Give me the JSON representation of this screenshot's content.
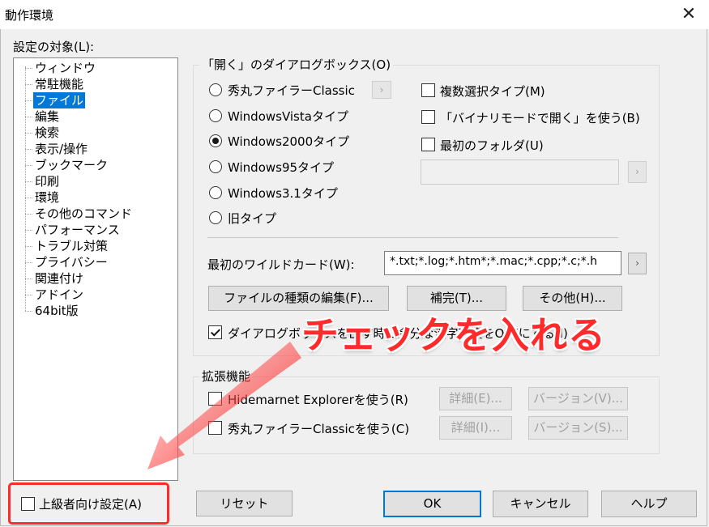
{
  "window": {
    "title": "動作環境",
    "close_glyph": "✕"
  },
  "tree": {
    "label": "設定の対象(L):",
    "items": [
      "ウィンドウ",
      "常駐機能",
      "ファイル",
      "編集",
      "検索",
      "表示/操作",
      "ブックマーク",
      "印刷",
      "環境",
      "その他のコマンド",
      "パフォーマンス",
      "トラブル対策",
      "プライバシー",
      "関連付け",
      "アドイン",
      "64bit版"
    ],
    "selected": "ファイル"
  },
  "open_dialog": {
    "title": "「開く」のダイアログボックス(O)",
    "radios": [
      "秀丸ファイラーClassic",
      "WindowsVistaタイプ",
      "Windows2000タイプ",
      "Windows95タイプ",
      "Windows3.1タイプ",
      "旧タイプ"
    ],
    "selected_radio": "Windows2000タイプ",
    "checkboxes": [
      {
        "label": "複数選択タイプ(M)",
        "checked": false
      },
      {
        "label": "「バイナリモードで開く」を使う(B)",
        "checked": false
      },
      {
        "label": "最初のフォルダ(U)",
        "checked": false
      }
    ],
    "folder_value": "",
    "wildcard_label": "最初のワイルドカード(W):",
    "wildcard_value": "*.txt;*.log;*.htm*;*.mac;*.cpp;*.c;*.h",
    "buttons": {
      "edit_types": "ファイルの種類の編集(F)...",
      "complete": "補完(T)...",
      "other": "その他(H)..."
    },
    "bottom_check": {
      "label": "ダイアログボックスを出す時に余分な漢字変換をOFFにする(I)",
      "checked": true
    },
    "arrow_glyph": "›"
  },
  "extension": {
    "title": "拡張機能",
    "rows": [
      {
        "label": "Hidemarnet Explorerを使う(R)",
        "detail": "詳細(E)...",
        "version": "バージョン(V)..."
      },
      {
        "label": "秀丸ファイラーClassicを使う(C)",
        "detail": "詳細(I)...",
        "version": "バージョン(S)..."
      }
    ]
  },
  "footer": {
    "advanced": "上級者向け設定(A)",
    "reset": "リセット",
    "ok": "OK",
    "cancel": "キャンセル",
    "help": "ヘルプ"
  },
  "annotation": {
    "text": "チェックを入れる",
    "color": "#ff2a2a"
  }
}
